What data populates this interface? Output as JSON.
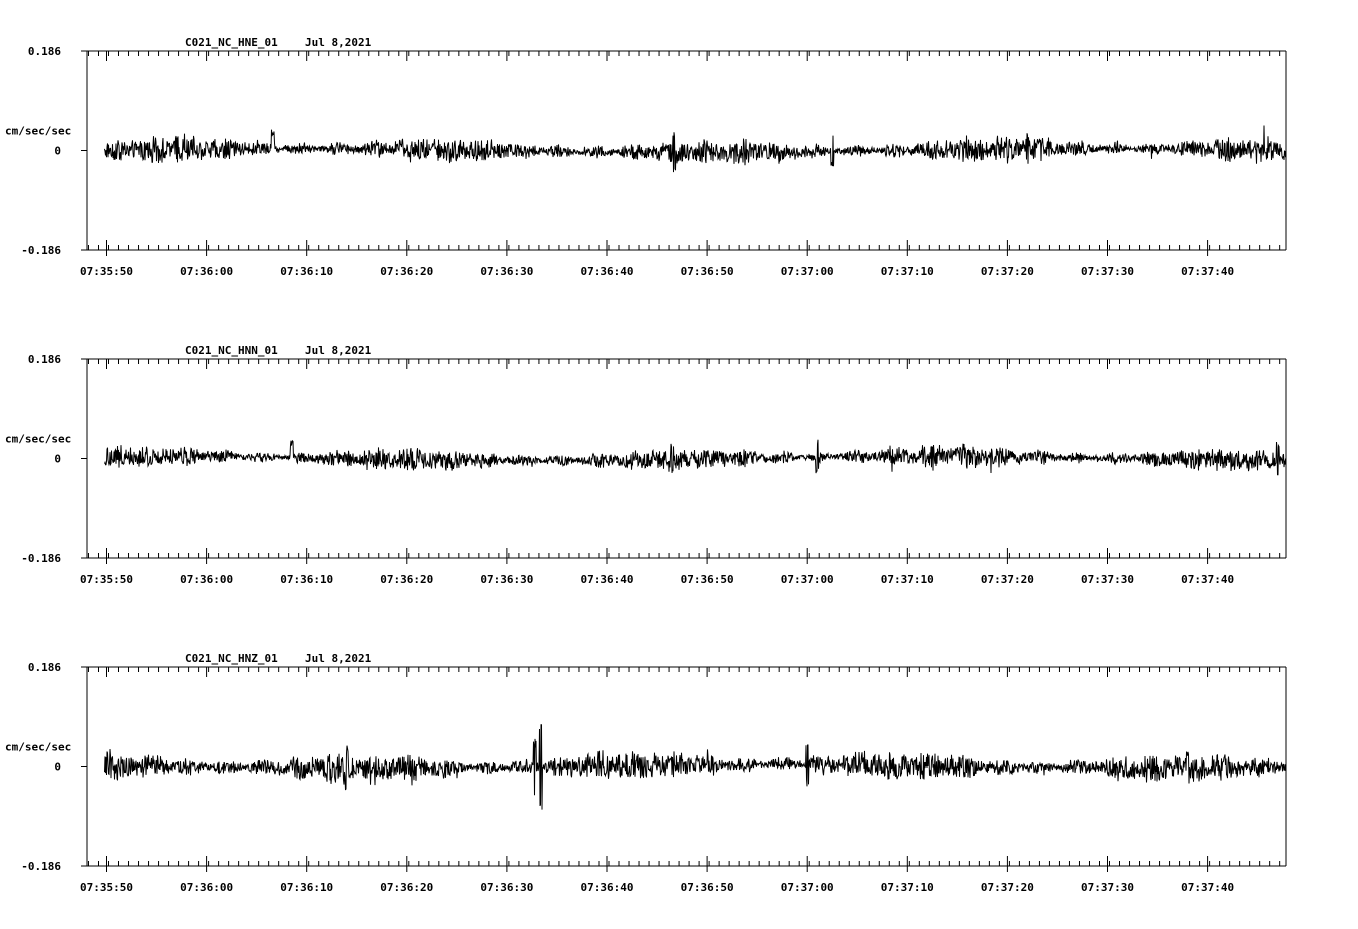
{
  "chart_data": [
    {
      "type": "line",
      "title_channel": "C021_NC_HNE_01",
      "title_date": "Jul 8,2021",
      "ylabel": "cm/sec/sec",
      "ylim": [
        -0.186,
        0.186
      ],
      "y_ticks": [
        "0.186",
        "0",
        "-0.186"
      ],
      "x_ticks": [
        "07:35:50",
        "07:36:00",
        "07:36:10",
        "07:36:20",
        "07:36:30",
        "07:36:40",
        "07:36:50",
        "07:37:00",
        "07:37:10",
        "07:37:20",
        "07:37:30",
        "07:37:40"
      ],
      "xlim_seconds": [
        0,
        118
      ],
      "trace_range_seconds": [
        1,
        118
      ],
      "noise_amplitude": 0.018,
      "spikes": [
        [
          7.0,
          0.03
        ],
        [
          16.6,
          0.035
        ],
        [
          56.7,
          0.04
        ],
        [
          72.5,
          0.032
        ],
        [
          92.0,
          0.03
        ]
      ]
    },
    {
      "type": "line",
      "title_channel": "C021_NC_HNN_01",
      "title_date": "Jul 8,2021",
      "ylabel": "cm/sec/sec",
      "ylim": [
        -0.186,
        0.186
      ],
      "y_ticks": [
        "0.186",
        "0",
        "-0.186"
      ],
      "x_ticks": [
        "07:35:50",
        "07:36:00",
        "07:36:10",
        "07:36:20",
        "07:36:30",
        "07:36:40",
        "07:36:50",
        "07:37:00",
        "07:37:10",
        "07:37:20",
        "07:37:30",
        "07:37:40"
      ],
      "xlim_seconds": [
        0,
        118
      ],
      "trace_range_seconds": [
        1,
        118
      ],
      "noise_amplitude": 0.016,
      "spikes": [
        [
          18.5,
          0.035
        ],
        [
          56.5,
          0.032
        ],
        [
          71.0,
          0.035
        ],
        [
          82.5,
          0.028
        ],
        [
          117.0,
          0.035
        ]
      ]
    },
    {
      "type": "line",
      "title_channel": "C021_NC_HNZ_01",
      "title_date": "Jul 8,2021",
      "ylabel": "cm/sec/sec",
      "ylim": [
        -0.186,
        0.186
      ],
      "y_ticks": [
        "0.186",
        "0",
        "-0.186"
      ],
      "x_ticks": [
        "07:35:50",
        "07:36:00",
        "07:36:10",
        "07:36:20",
        "07:36:30",
        "07:36:40",
        "07:36:50",
        "07:37:00",
        "07:37:10",
        "07:37:20",
        "07:37:30",
        "07:37:40"
      ],
      "xlim_seconds": [
        0,
        118
      ],
      "trace_range_seconds": [
        1,
        118
      ],
      "noise_amplitude": 0.022,
      "spikes": [
        [
          24.0,
          0.045
        ],
        [
          42.8,
          0.055
        ],
        [
          43.4,
          0.08
        ],
        [
          70.0,
          0.045
        ],
        [
          108.0,
          0.04
        ]
      ]
    }
  ]
}
